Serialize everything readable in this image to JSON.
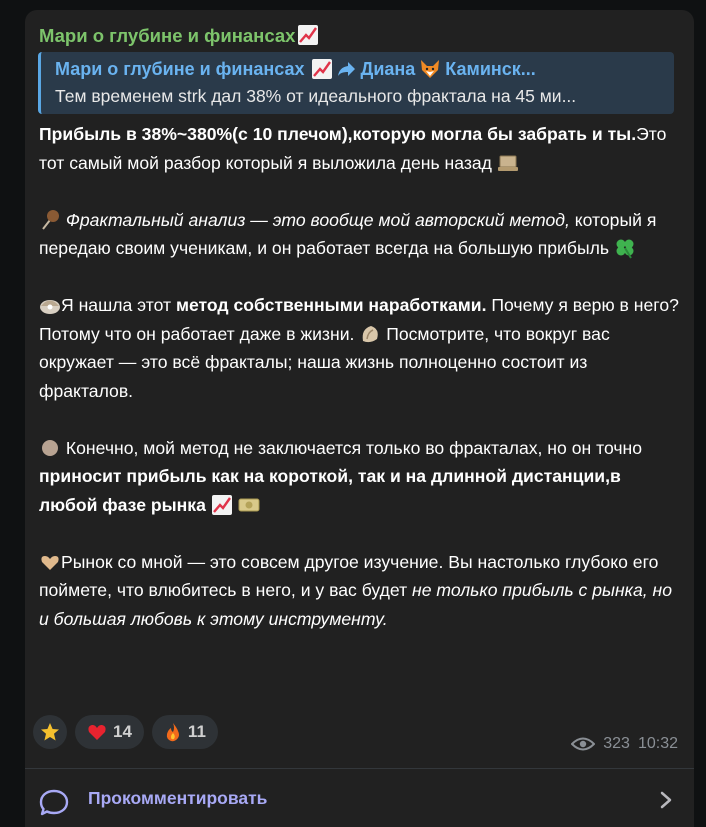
{
  "post": {
    "channel_name": "Мари о глубине и финансах",
    "reply": {
      "title_channel": "Мари о глубине и финансах",
      "title_user": "Диана",
      "title_rest": "Каминск...",
      "text": "Тем временем strk дал 38% от идеального фрактала на 45 ми..."
    },
    "p1": {
      "bold": "Прибыль в 38%~380%(с 10 плечом),которую могла бы забрать и ты.",
      "rest": "Это тот самый мой разбор который я выложила день назад"
    },
    "p2": {
      "italic": "Фрактальный анализ — это вообще мой авторский метод,",
      "rest": " который я передаю своим ученикам, и он работает всегда на большую прибыль "
    },
    "p3": {
      "a": "Я нашла этот ",
      "bold": "метод собственными наработками.",
      "b": " Почему я верю в него? Потому что он работает даже в жизни. ",
      "c": "Посмотрите, что вокруг вас окружает — это всё фракталы; наша жизнь полноценно состоит из фракталов."
    },
    "p4": {
      "a": " Конечно, мой метод не заключается только во фракталах, но он точно ",
      "bold": "приносит прибыль как на короткой, так и на длинной дистанции,в любой фазе рынка"
    },
    "p5": {
      "a": "Рынок со мной — это совсем другое изучение. Вы настолько глубоко его поймете, что влюбитесь в него, и у вас будет ",
      "italic": "не только прибыль с рынка, но и большая любовь к этому инструменту."
    },
    "reactions": {
      "heart_count": "14",
      "fire_count": "11"
    },
    "views": "323",
    "time": "10:32",
    "comment_label": "Прокомментировать"
  },
  "colors": {
    "channel": "#7dc46b",
    "reply_title": "#6ab3f0",
    "comment": "#a8a9f5"
  }
}
